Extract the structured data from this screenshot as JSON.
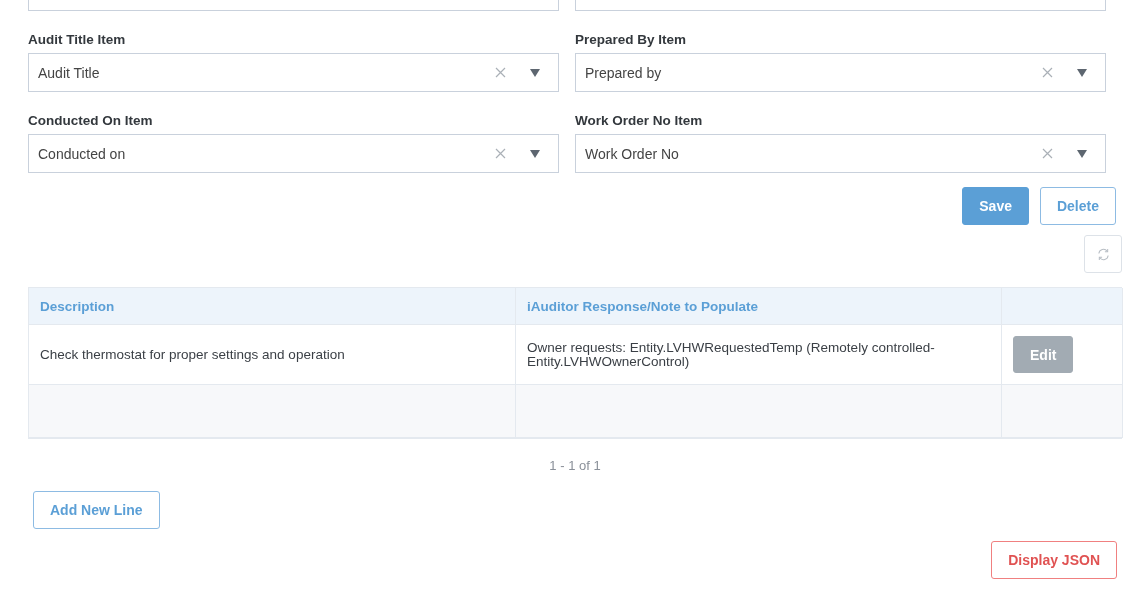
{
  "top_fields_cut": [
    {
      "kind": "select"
    },
    {
      "kind": "select"
    }
  ],
  "fields": [
    {
      "label": "Audit Title Item",
      "value": "Audit Title"
    },
    {
      "label": "Prepared By Item",
      "value": "Prepared by"
    },
    {
      "label": "Conducted On Item",
      "value": "Conducted on"
    },
    {
      "label": "Work Order No Item",
      "value": "Work Order No"
    }
  ],
  "actions": {
    "save": "Save",
    "delete": "Delete"
  },
  "table": {
    "columns": [
      "Description",
      "iAuditor Response/Note to Populate"
    ],
    "rows": [
      {
        "description": "Check thermostat for proper settings and operation",
        "response": "Owner requests: Entity.LVHWRequestedTemp (Remotely controlled-Entity.LVHWOwnerControl)",
        "action": "Edit"
      }
    ]
  },
  "pagination": "1 - 1 of 1",
  "add_button": "Add New Line",
  "json_button": "Display JSON"
}
